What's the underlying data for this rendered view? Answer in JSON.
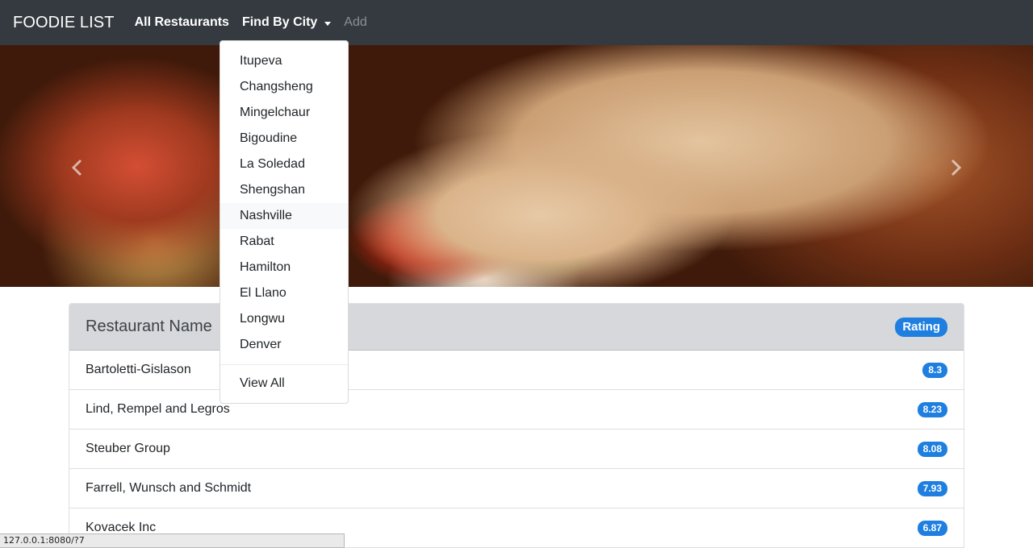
{
  "navbar": {
    "brand": "FOODIE LIST",
    "links": {
      "all_restaurants": "All Restaurants",
      "find_by_city": "Find By City",
      "add": "Add"
    }
  },
  "dropdown": {
    "cities": [
      "Itupeva",
      "Changsheng",
      "Mingelchaur",
      "Bigoudine",
      "La Soledad",
      "Shengshan",
      "Nashville",
      "Rabat",
      "Hamilton",
      "El Llano",
      "Longwu",
      "Denver"
    ],
    "hovered": "Nashville",
    "view_all": "View All"
  },
  "carousel": {
    "prev_icon": "chevron-left-icon",
    "next_icon": "chevron-right-icon"
  },
  "table": {
    "header": {
      "name": "Restaurant Name",
      "rating": "Rating"
    },
    "rows": [
      {
        "name": "Bartoletti-Gislason",
        "rating": "8.3"
      },
      {
        "name": "Lind, Rempel and Legros",
        "rating": "8.23"
      },
      {
        "name": "Steuber Group",
        "rating": "8.08"
      },
      {
        "name": "Farrell, Wunsch and Schmidt",
        "rating": "7.93"
      },
      {
        "name": "Kovacek Inc",
        "rating": "6.87"
      }
    ]
  },
  "status_bar": {
    "url": "127.0.0.1:8080/?7"
  },
  "colors": {
    "navbar": "#343a40",
    "badge": "#1e7fe0",
    "table_header": "#d6d8db"
  }
}
